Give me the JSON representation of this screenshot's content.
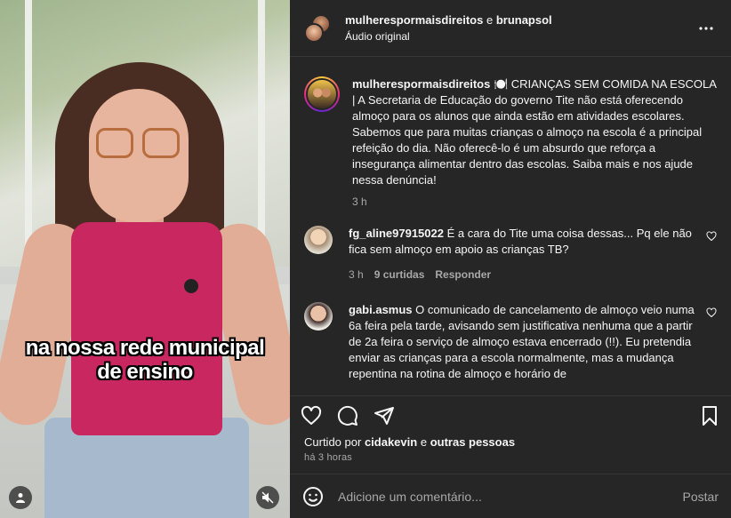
{
  "video": {
    "caption_line1": "na nossa rede municipal",
    "caption_line2": "de ensino",
    "user_icon": "user-icon",
    "mute_icon": "muted-speaker-icon"
  },
  "header": {
    "user1": "mulherespormaisdireitos",
    "and": "e",
    "user2": "brunapsol",
    "audio": "Áudio original",
    "more_icon": "more-horizontal-icon"
  },
  "post": {
    "username": "mulherespormaisdireitos",
    "text": "🍽️ CRIANÇAS SEM COMIDA NA ESCOLA | A Secretaria de Educação do governo Tite não está oferecendo almoço para os alunos que ainda estão em atividades escolares. Sabemos que para muitas crianças o almoço na escola é a principal refeição do dia. Não oferecê-lo é um absurdo que reforça a insegurança alimentar dentro das escolas. Saiba mais e nos ajude nessa denúncia!",
    "time": "3 h"
  },
  "comments": [
    {
      "username": "fg_aline97915022",
      "text": "É a cara do Tite uma coisa dessas... Pq ele não fica sem almoço em apoio as crianças TB?",
      "time": "3 h",
      "likes": "9 curtidas",
      "reply": "Responder"
    },
    {
      "username": "gabi.asmus",
      "text": "O comunicado de cancelamento de almoço veio numa 6a feira pela tarde, avisando sem justificativa nenhuma que a partir de 2a feira o serviço de almoço estava encerrado (!!). Eu pretendia enviar as crianças para a escola normalmente, mas a mudança repentina na rotina de almoço e horário de"
    }
  ],
  "actions": {
    "like_icon": "heart-icon",
    "comment_icon": "comment-icon",
    "share_icon": "send-icon",
    "save_icon": "bookmark-icon"
  },
  "likes": {
    "prefix": "Curtido por",
    "user": "cidakevin",
    "and": "e",
    "others": "outras pessoas"
  },
  "when": "há 3 horas",
  "add_comment": {
    "placeholder": "Adicione um comentário...",
    "post_label": "Postar",
    "emoji_icon": "emoji-icon"
  }
}
